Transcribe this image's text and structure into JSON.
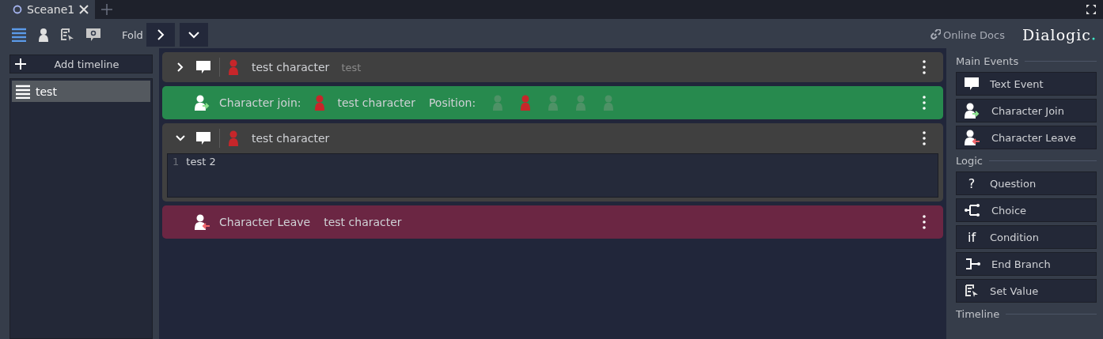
{
  "tabs": [
    {
      "label": "Sceane1",
      "selected": true
    }
  ],
  "toolbar": {
    "fold_label": "Fold",
    "online_docs": "Online Docs",
    "logo": "Dialogic"
  },
  "sidebar": {
    "add_button": "Add timeline",
    "timelines": [
      {
        "name": "test",
        "selected": true
      }
    ]
  },
  "events": [
    {
      "kind": "text",
      "expanded": false,
      "character": "test character",
      "preview": "test"
    },
    {
      "kind": "join",
      "label": "Character join:",
      "character": "test character",
      "position_label": "Position:",
      "positions": [
        {
          "selected": false
        },
        {
          "selected": true
        },
        {
          "selected": false
        },
        {
          "selected": false
        },
        {
          "selected": false
        }
      ]
    },
    {
      "kind": "text",
      "expanded": true,
      "character": "test character",
      "lines": [
        {
          "number": "1",
          "text": "test 2"
        }
      ]
    },
    {
      "kind": "leave",
      "label": "Character Leave",
      "character": "test character"
    }
  ],
  "palette": [
    {
      "title": "Main Events",
      "items": [
        {
          "label": "Text Event",
          "kind": "text"
        },
        {
          "label": "Character Join",
          "kind": "join"
        },
        {
          "label": "Character Leave",
          "kind": "leave"
        }
      ]
    },
    {
      "title": "Logic",
      "items": [
        {
          "label": "Question",
          "kind": "glyph",
          "glyph": "?"
        },
        {
          "label": "Choice",
          "kind": "choice"
        },
        {
          "label": "Condition",
          "kind": "glyph",
          "glyph": "if"
        },
        {
          "label": "End Branch",
          "kind": "branch"
        },
        {
          "label": "Set Value",
          "kind": "setvalue"
        }
      ]
    },
    {
      "title": "Timeline"
    }
  ]
}
